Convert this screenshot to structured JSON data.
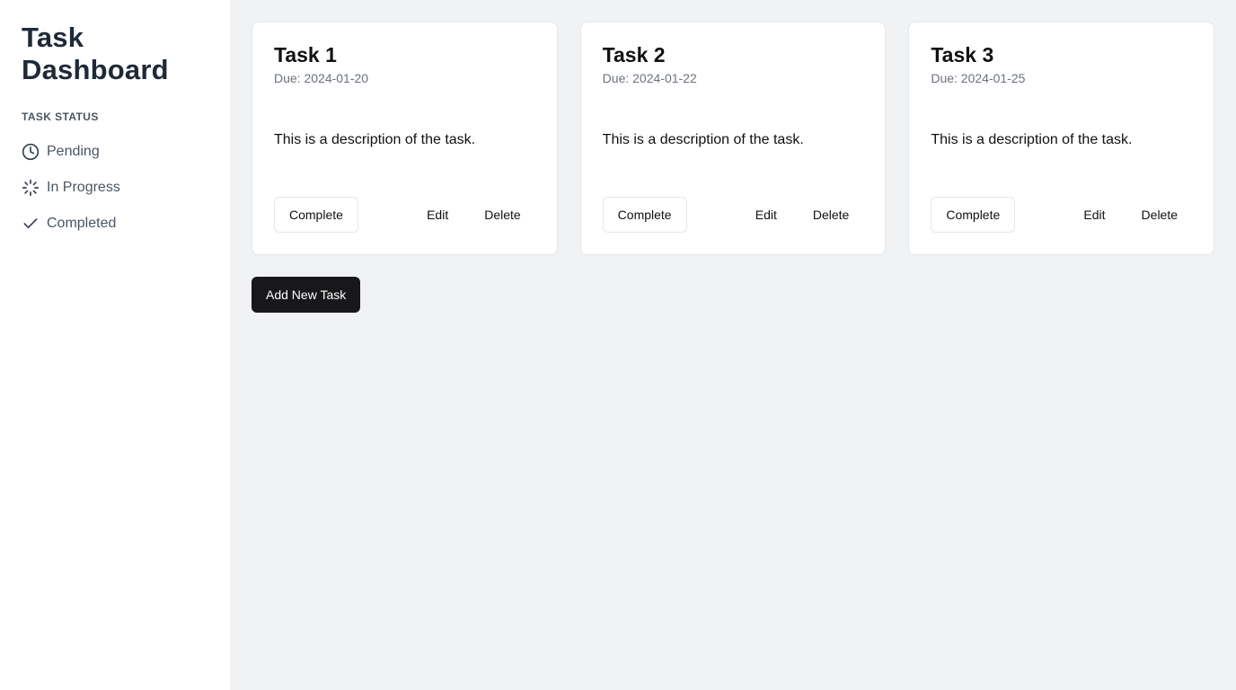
{
  "sidebar": {
    "title": "Task Dashboard",
    "section_label": "TASK STATUS",
    "items": [
      {
        "label": "Pending",
        "icon": "clock-icon"
      },
      {
        "label": "In Progress",
        "icon": "loader-icon"
      },
      {
        "label": "Completed",
        "icon": "check-icon"
      }
    ]
  },
  "tasks": [
    {
      "title": "Task 1",
      "due": "Due: 2024-01-20",
      "description": "This is a description of the task.",
      "complete_label": "Complete",
      "edit_label": "Edit",
      "delete_label": "Delete"
    },
    {
      "title": "Task 2",
      "due": "Due: 2024-01-22",
      "description": "This is a description of the task.",
      "complete_label": "Complete",
      "edit_label": "Edit",
      "delete_label": "Delete"
    },
    {
      "title": "Task 3",
      "due": "Due: 2024-01-25",
      "description": "This is a description of the task.",
      "complete_label": "Complete",
      "edit_label": "Edit",
      "delete_label": "Delete"
    }
  ],
  "add_button_label": "Add New Task",
  "colors": {
    "sidebar_bg": "#ffffff",
    "main_bg": "#f1f2f4",
    "primary_button": "#18181b",
    "muted_text": "#6b7280"
  }
}
